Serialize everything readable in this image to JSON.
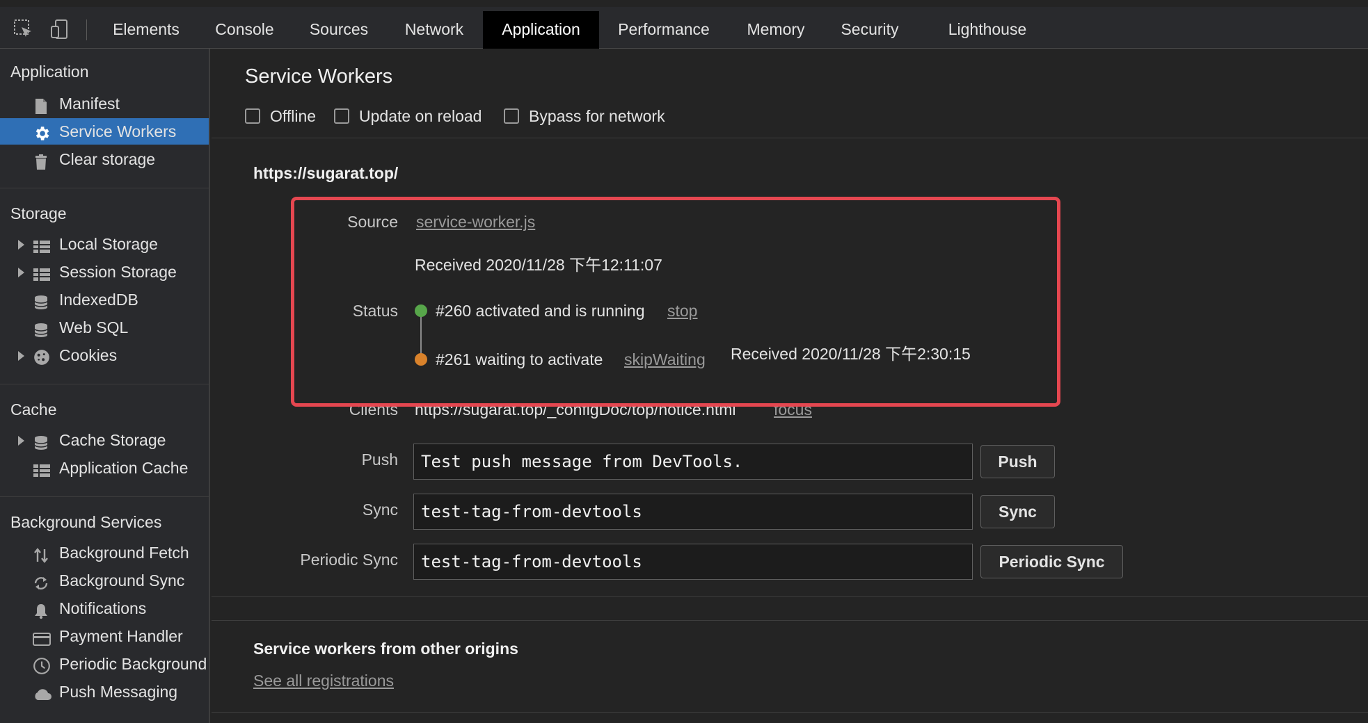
{
  "tabs": [
    {
      "label": "Elements"
    },
    {
      "label": "Console"
    },
    {
      "label": "Sources"
    },
    {
      "label": "Network"
    },
    {
      "label": "Application",
      "active": true
    },
    {
      "label": "Performance"
    },
    {
      "label": "Memory"
    },
    {
      "label": "Security"
    },
    {
      "label": "Lighthouse"
    }
  ],
  "sidebar": {
    "application": {
      "title": "Application",
      "items": [
        {
          "label": "Manifest",
          "icon": "file-icon"
        },
        {
          "label": "Service Workers",
          "icon": "gear-icon",
          "selected": true
        },
        {
          "label": "Clear storage",
          "icon": "trash-icon"
        }
      ]
    },
    "storage": {
      "title": "Storage",
      "items": [
        {
          "label": "Local Storage",
          "icon": "grid-icon"
        },
        {
          "label": "Session Storage",
          "icon": "grid-icon"
        },
        {
          "label": "IndexedDB",
          "icon": "database-icon"
        },
        {
          "label": "Web SQL",
          "icon": "database-icon"
        },
        {
          "label": "Cookies",
          "icon": "cookie-icon"
        }
      ]
    },
    "cache": {
      "title": "Cache",
      "items": [
        {
          "label": "Cache Storage",
          "icon": "database-icon"
        },
        {
          "label": "Application Cache",
          "icon": "grid-icon"
        }
      ]
    },
    "background": {
      "title": "Background Services",
      "items": [
        {
          "label": "Background Fetch",
          "icon": "arrows-updown-icon"
        },
        {
          "label": "Background Sync",
          "icon": "sync-icon"
        },
        {
          "label": "Notifications",
          "icon": "bell-icon"
        },
        {
          "label": "Payment Handler",
          "icon": "card-icon"
        },
        {
          "label": "Periodic Background Sync",
          "icon": "clock-icon"
        },
        {
          "label": "Push Messaging",
          "icon": "cloud-icon"
        }
      ]
    }
  },
  "main": {
    "title": "Service Workers",
    "checkboxes": {
      "offline": "Offline",
      "update_on_reload": "Update on reload",
      "bypass_for_network": "Bypass for network"
    },
    "origin": "https://sugarat.top/",
    "source_label": "Source",
    "source_link": "service-worker.js",
    "received_1": "Received 2020/11/28 下午12:11:07",
    "status_label": "Status",
    "status_1": "#260 activated and is running",
    "status_1_action": "stop",
    "status_1_color": "#57a64a",
    "status_2": "#261 waiting to activate",
    "status_2_action": "skipWaiting",
    "status_2_color": "#d9822b",
    "received_2": "Received 2020/11/28 下午2:30:15",
    "clients_label": "Clients",
    "clients_value": "https://sugarat.top/_configDoc/top/notice.html",
    "clients_action": "focus",
    "push_label": "Push",
    "push_value": "Test push message from DevTools.",
    "push_button": "Push",
    "sync_label": "Sync",
    "sync_value": "test-tag-from-devtools",
    "sync_button": "Sync",
    "periodic_label": "Periodic Sync",
    "periodic_value": "test-tag-from-devtools",
    "periodic_button": "Periodic Sync",
    "other_title": "Service workers from other origins",
    "see_all": "See all registrations",
    "highlight_color": "#e54750"
  }
}
